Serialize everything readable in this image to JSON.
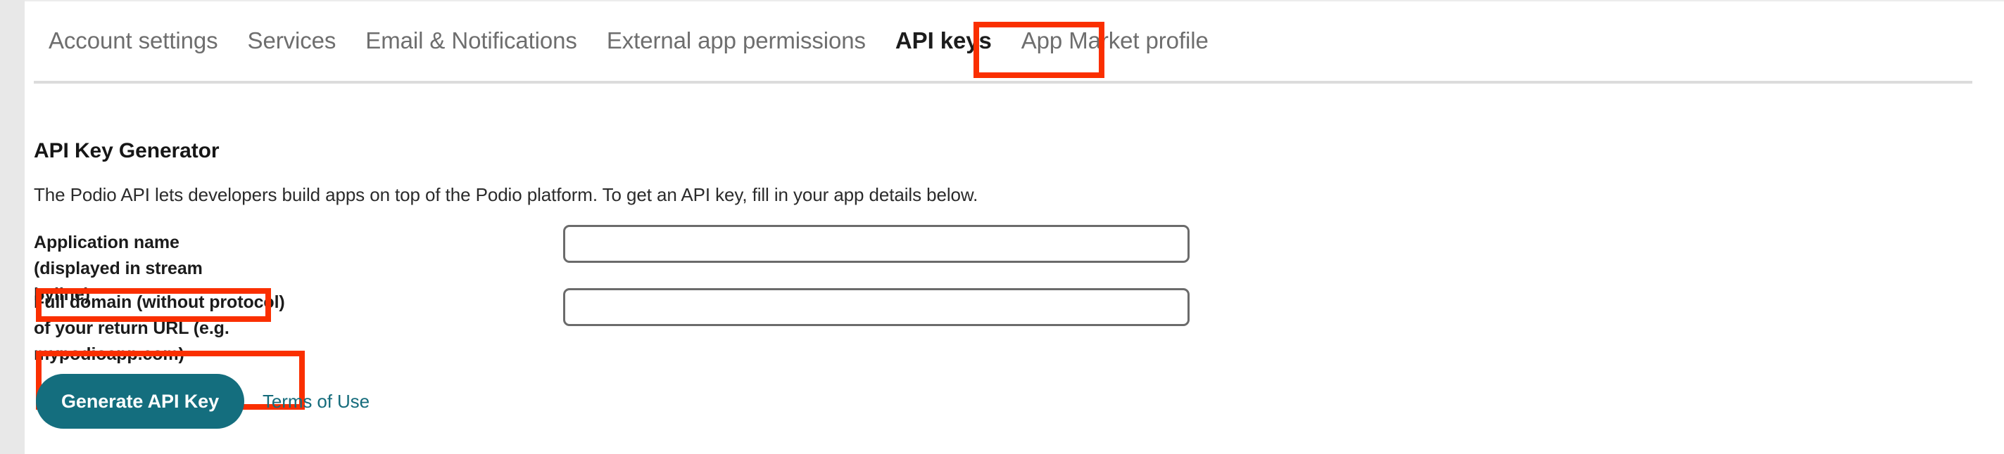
{
  "chrome": {
    "left_rail_color": "#e8e8e8",
    "background_color": "#ffffff"
  },
  "annotation": {
    "color": "#fa2f00",
    "targets": [
      "tab-api-keys",
      "label-application-name",
      "label-full-domain"
    ]
  },
  "tabs": {
    "items": [
      {
        "label": "Account settings",
        "active": false
      },
      {
        "label": "Services",
        "active": false
      },
      {
        "label": "Email & Notifications",
        "active": false
      },
      {
        "label": "External app permissions",
        "active": false
      },
      {
        "label": "API keys",
        "active": true
      },
      {
        "label": "App Market profile",
        "active": false
      }
    ]
  },
  "main": {
    "title": "API Key Generator",
    "description": "The Podio API lets developers build apps on top of the Podio platform. To get an API key, fill in your app details below.",
    "fields": [
      {
        "label": "Application name (displayed in stream byline)",
        "value": "",
        "placeholder": ""
      },
      {
        "label": "Full domain (without protocol) of your return URL (e.g. mypodioapp.com)",
        "value": "",
        "placeholder": ""
      }
    ],
    "actions": {
      "generate_label": "Generate API Key",
      "generate_color": "#146E7E",
      "terms_label": "Terms of Use",
      "terms_color": "#156C7C"
    }
  }
}
